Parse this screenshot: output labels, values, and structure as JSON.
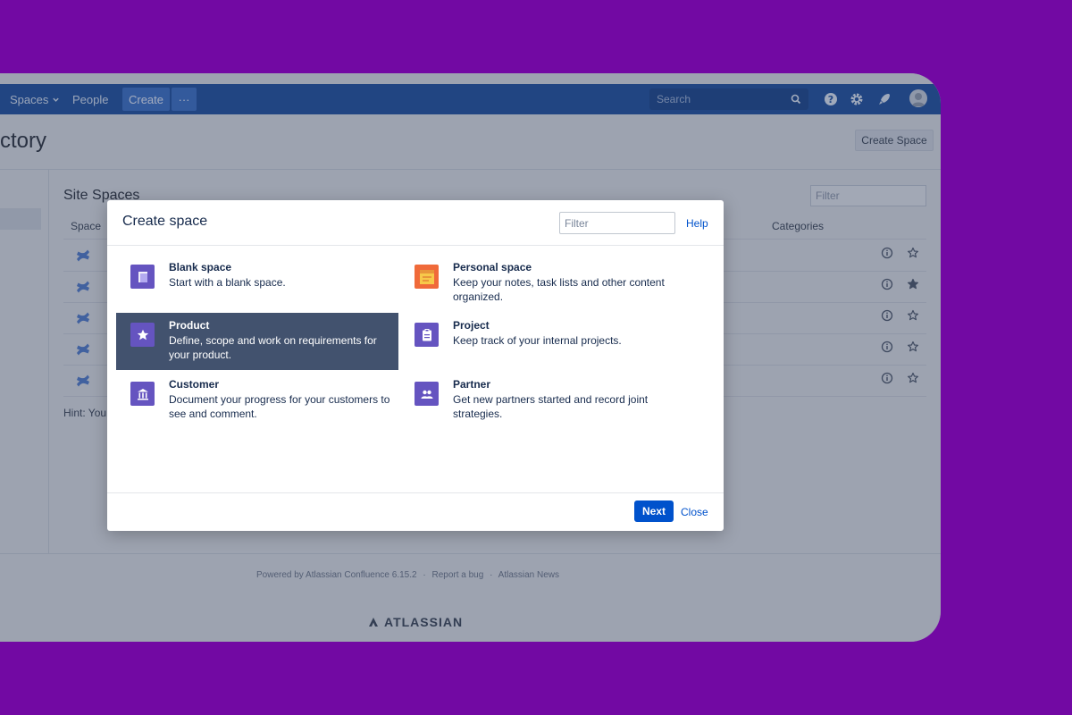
{
  "topbar": {
    "spaces_label": "Spaces",
    "people_label": "People",
    "create_label": "Create",
    "more_label": "···",
    "search_placeholder": "Search"
  },
  "page": {
    "title": "ctory",
    "create_space_label": "Create Space",
    "site_spaces_heading": "Site Spaces",
    "filter_placeholder": "Filter",
    "col_space": "Space",
    "col_categories": "Categories",
    "hint_text": "Hint: You"
  },
  "footer": {
    "powered": "Powered by Atlassian Confluence 6.15.2",
    "sep": "·",
    "report_bug": "Report a bug",
    "news": "Atlassian News",
    "brand": "ATLASSIAN"
  },
  "modal": {
    "title": "Create space",
    "filter_placeholder": "Filter",
    "help_label": "Help",
    "next_label": "Next",
    "close_label": "Close",
    "templates": [
      {
        "name": "Blank space",
        "desc": "Start with a blank space.",
        "icon": "blank-page-icon",
        "selected": false
      },
      {
        "name": "Personal space",
        "desc": "Keep your notes, task lists and other content organized.",
        "icon": "personal-space-icon",
        "selected": false
      },
      {
        "name": "Product",
        "desc": "Define, scope and work on requirements for your product.",
        "icon": "star-icon",
        "selected": true
      },
      {
        "name": "Project",
        "desc": "Keep track of your internal projects.",
        "icon": "clipboard-icon",
        "selected": false
      },
      {
        "name": "Customer",
        "desc": "Document your progress for your customers to see and comment.",
        "icon": "bank-icon",
        "selected": false
      },
      {
        "name": "Partner",
        "desc": "Get new partners started and record joint strategies.",
        "icon": "people-icon",
        "selected": false
      }
    ]
  },
  "colors": {
    "background": "#7209a3",
    "topbar": "#1e4e9a",
    "primary": "#0052cc",
    "selected_tile": "#42526e",
    "template_icon": "#6554c0"
  }
}
